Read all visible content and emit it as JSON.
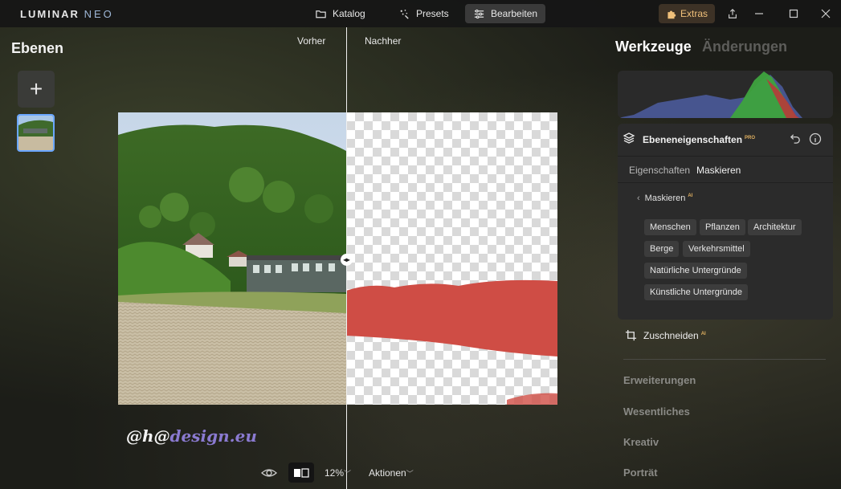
{
  "app": {
    "logo_main": "LUMINAR",
    "logo_accent": "NEO"
  },
  "nav": {
    "katalog": "Katalog",
    "presets": "Presets",
    "bearbeiten": "Bearbeiten",
    "active": "bearbeiten"
  },
  "header_right": {
    "extras": "Extras"
  },
  "left_panel": {
    "title": "Ebenen"
  },
  "canvas": {
    "before_label": "Vorher",
    "after_label": "Nachher",
    "watermark_prefix": "@",
    "watermark_h": "h",
    "watermark_at": "@",
    "watermark_domain": "design.eu"
  },
  "bottom_bar": {
    "zoom": "12%",
    "actions": "Aktionen"
  },
  "right_panel": {
    "tab_tools": "Werkzeuge",
    "tab_changes": "Änderungen",
    "props_title": "Ebeneneigenschaften",
    "pro_badge": "PRO",
    "subtab_properties": "Eigenschaften",
    "subtab_mask": "Maskieren",
    "mask_back": "Maskieren",
    "ai_badge": "AI",
    "chips": [
      "Menschen",
      "Pflanzen",
      "Architektur",
      "Berge",
      "Verkehrsmittel",
      "Natürliche Untergründe",
      "Künstliche Untergründe"
    ],
    "crop": "Zuschneiden",
    "sections": [
      "Erweiterungen",
      "Wesentliches",
      "Kreativ",
      "Porträt"
    ]
  },
  "colors": {
    "accent_blue": "#6aa7ff",
    "extras_orange": "#f0c07a",
    "pro_gold": "#e0b060"
  }
}
